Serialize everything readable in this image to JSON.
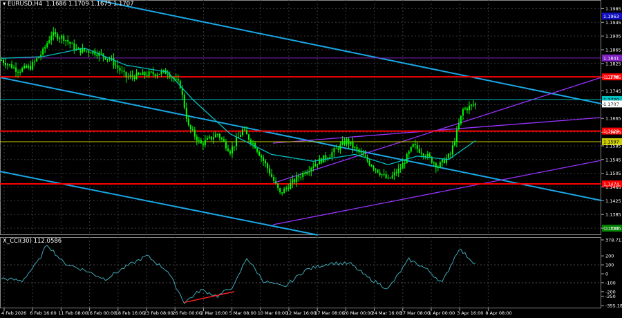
{
  "chart_header": {
    "symbol": "EURUSD,H4",
    "ohlc": "1.1686 1.1709 1.1675 1.1707"
  },
  "indicator_header": {
    "name": "X_CCI(30)",
    "value": "112.0586"
  },
  "colors": {
    "background": "#000000",
    "candle": "#00ff00",
    "ma": "#00c0c0",
    "channel_blue": "#19a7e6",
    "channel_purple": "#9933ff",
    "red_level": "#ff0000",
    "yellow_level": "#cccc00",
    "cci_line": "#3fa7b5",
    "divergence": "#ff2020"
  },
  "price_axis": {
    "ticks": [
      "1.1985",
      "1.1945",
      "1.1905",
      "1.1865",
      "1.1825",
      "1.1785",
      "1.1745",
      "1.1705",
      "1.1665",
      "1.1625",
      "1.1585",
      "1.1545",
      "1.1505",
      "1.1465",
      "1.1425",
      "1.1385",
      "1.1345"
    ]
  },
  "price_levels": [
    {
      "name": "blue-level",
      "label": "1.1963",
      "price": 1.1963,
      "color": "#1010c0",
      "line": false
    },
    {
      "name": "purple-level",
      "label": "1.1841",
      "price": 1.1841,
      "color": "#8020c0",
      "line": true
    },
    {
      "name": "red-level-upper",
      "label": "1.1786",
      "price": 1.1786,
      "color": "#ff0000",
      "line": true
    },
    {
      "name": "current-price",
      "label": "1.1720",
      "price": 1.172,
      "color": "#00c0c0",
      "line": true
    },
    {
      "name": "current-price-2",
      "label": "1.1707",
      "price": 1.1707,
      "color": "#ffffff",
      "line": false
    },
    {
      "name": "red-level-middle",
      "label": "1.1628",
      "price": 1.1628,
      "color": "#ff0000",
      "line": true
    },
    {
      "name": "yellow-level",
      "label": "1.1597",
      "price": 1.1597,
      "color": "#cccc00",
      "line": true
    },
    {
      "name": "red-level-lower",
      "label": "1.1474",
      "price": 1.1474,
      "color": "#ff0000",
      "line": true
    },
    {
      "name": "green-level",
      "label": "1.1345",
      "price": 1.1345,
      "color": "#008000",
      "line": false
    }
  ],
  "cci_axis": {
    "ticks": [
      "378.7116",
      "200",
      "100",
      "0",
      "-100",
      "-200",
      "-250",
      "-355.1895"
    ]
  },
  "time_axis": {
    "labels": [
      "4 Feb 2026",
      "6 Feb 16:00",
      "11 Feb 08:00",
      "16 Feb 00:00",
      "18 Feb 16:00",
      "23 Feb 08:00",
      "26 Feb 00:00",
      "2 Mar 16:00",
      "5 Mar 08:00",
      "10 Mar 00:00",
      "12 Mar 16:00",
      "17 Mar 08:00",
      "20 Mar 00:00",
      "24 Mar 16:00",
      "27 Mar 08:00",
      "1 Apr 00:00",
      "3 Apr 16:00",
      "8 Apr 08:00"
    ]
  },
  "chart_data": {
    "type": "candlestick",
    "symbol": "EURUSD",
    "timeframe": "H4",
    "ylim": [
      1.1325,
      1.201
    ],
    "close_path": [
      {
        "t": 0,
        "close": 1.1835
      },
      {
        "t": 8,
        "close": 1.1805
      },
      {
        "t": 14,
        "close": 1.1815
      },
      {
        "t": 20,
        "close": 1.186
      },
      {
        "t": 24,
        "close": 1.191
      },
      {
        "t": 30,
        "close": 1.19
      },
      {
        "t": 36,
        "close": 1.1865
      },
      {
        "t": 44,
        "close": 1.186
      },
      {
        "t": 52,
        "close": 1.184
      },
      {
        "t": 60,
        "close": 1.1785
      },
      {
        "t": 66,
        "close": 1.179
      },
      {
        "t": 72,
        "close": 1.1795
      },
      {
        "t": 80,
        "close": 1.18
      },
      {
        "t": 86,
        "close": 1.176
      },
      {
        "t": 90,
        "close": 1.164
      },
      {
        "t": 96,
        "close": 1.159
      },
      {
        "t": 104,
        "close": 1.162
      },
      {
        "t": 110,
        "close": 1.157
      },
      {
        "t": 116,
        "close": 1.163
      },
      {
        "t": 122,
        "close": 1.1585
      },
      {
        "t": 128,
        "close": 1.152
      },
      {
        "t": 134,
        "close": 1.1445
      },
      {
        "t": 142,
        "close": 1.149
      },
      {
        "t": 150,
        "close": 1.153
      },
      {
        "t": 158,
        "close": 1.156
      },
      {
        "t": 166,
        "close": 1.16
      },
      {
        "t": 172,
        "close": 1.1565
      },
      {
        "t": 178,
        "close": 1.153
      },
      {
        "t": 186,
        "close": 1.1485
      },
      {
        "t": 192,
        "close": 1.152
      },
      {
        "t": 198,
        "close": 1.1585
      },
      {
        "t": 204,
        "close": 1.156
      },
      {
        "t": 210,
        "close": 1.1525
      },
      {
        "t": 216,
        "close": 1.156
      },
      {
        "t": 222,
        "close": 1.169
      },
      {
        "t": 228,
        "close": 1.1707
      }
    ],
    "moving_average": [
      {
        "t": 0,
        "value": 1.184
      },
      {
        "t": 20,
        "value": 1.1845
      },
      {
        "t": 40,
        "value": 1.187
      },
      {
        "t": 60,
        "value": 1.182
      },
      {
        "t": 80,
        "value": 1.18
      },
      {
        "t": 92,
        "value": 1.172
      },
      {
        "t": 110,
        "value": 1.162
      },
      {
        "t": 130,
        "value": 1.156
      },
      {
        "t": 150,
        "value": 1.154
      },
      {
        "t": 170,
        "value": 1.156
      },
      {
        "t": 186,
        "value": 1.153
      },
      {
        "t": 200,
        "value": 1.1555
      },
      {
        "t": 215,
        "value": 1.1545
      },
      {
        "t": 228,
        "value": 1.16
      }
    ],
    "cci": [
      {
        "t": 0,
        "value": -50
      },
      {
        "t": 10,
        "value": -80
      },
      {
        "t": 18,
        "value": 150
      },
      {
        "t": 22,
        "value": 330
      },
      {
        "t": 30,
        "value": 120
      },
      {
        "t": 40,
        "value": 40
      },
      {
        "t": 50,
        "value": -60
      },
      {
        "t": 60,
        "value": 80
      },
      {
        "t": 70,
        "value": 200
      },
      {
        "t": 80,
        "value": 30
      },
      {
        "t": 88,
        "value": -320
      },
      {
        "t": 96,
        "value": -180
      },
      {
        "t": 104,
        "value": -250
      },
      {
        "t": 112,
        "value": -130
      },
      {
        "t": 118,
        "value": 180
      },
      {
        "t": 126,
        "value": -80
      },
      {
        "t": 136,
        "value": -150
      },
      {
        "t": 146,
        "value": 40
      },
      {
        "t": 158,
        "value": 120
      },
      {
        "t": 168,
        "value": 110
      },
      {
        "t": 176,
        "value": -40
      },
      {
        "t": 186,
        "value": -170
      },
      {
        "t": 196,
        "value": 160
      },
      {
        "t": 204,
        "value": 60
      },
      {
        "t": 212,
        "value": -100
      },
      {
        "t": 220,
        "value": 280
      },
      {
        "t": 228,
        "value": 112
      }
    ]
  }
}
